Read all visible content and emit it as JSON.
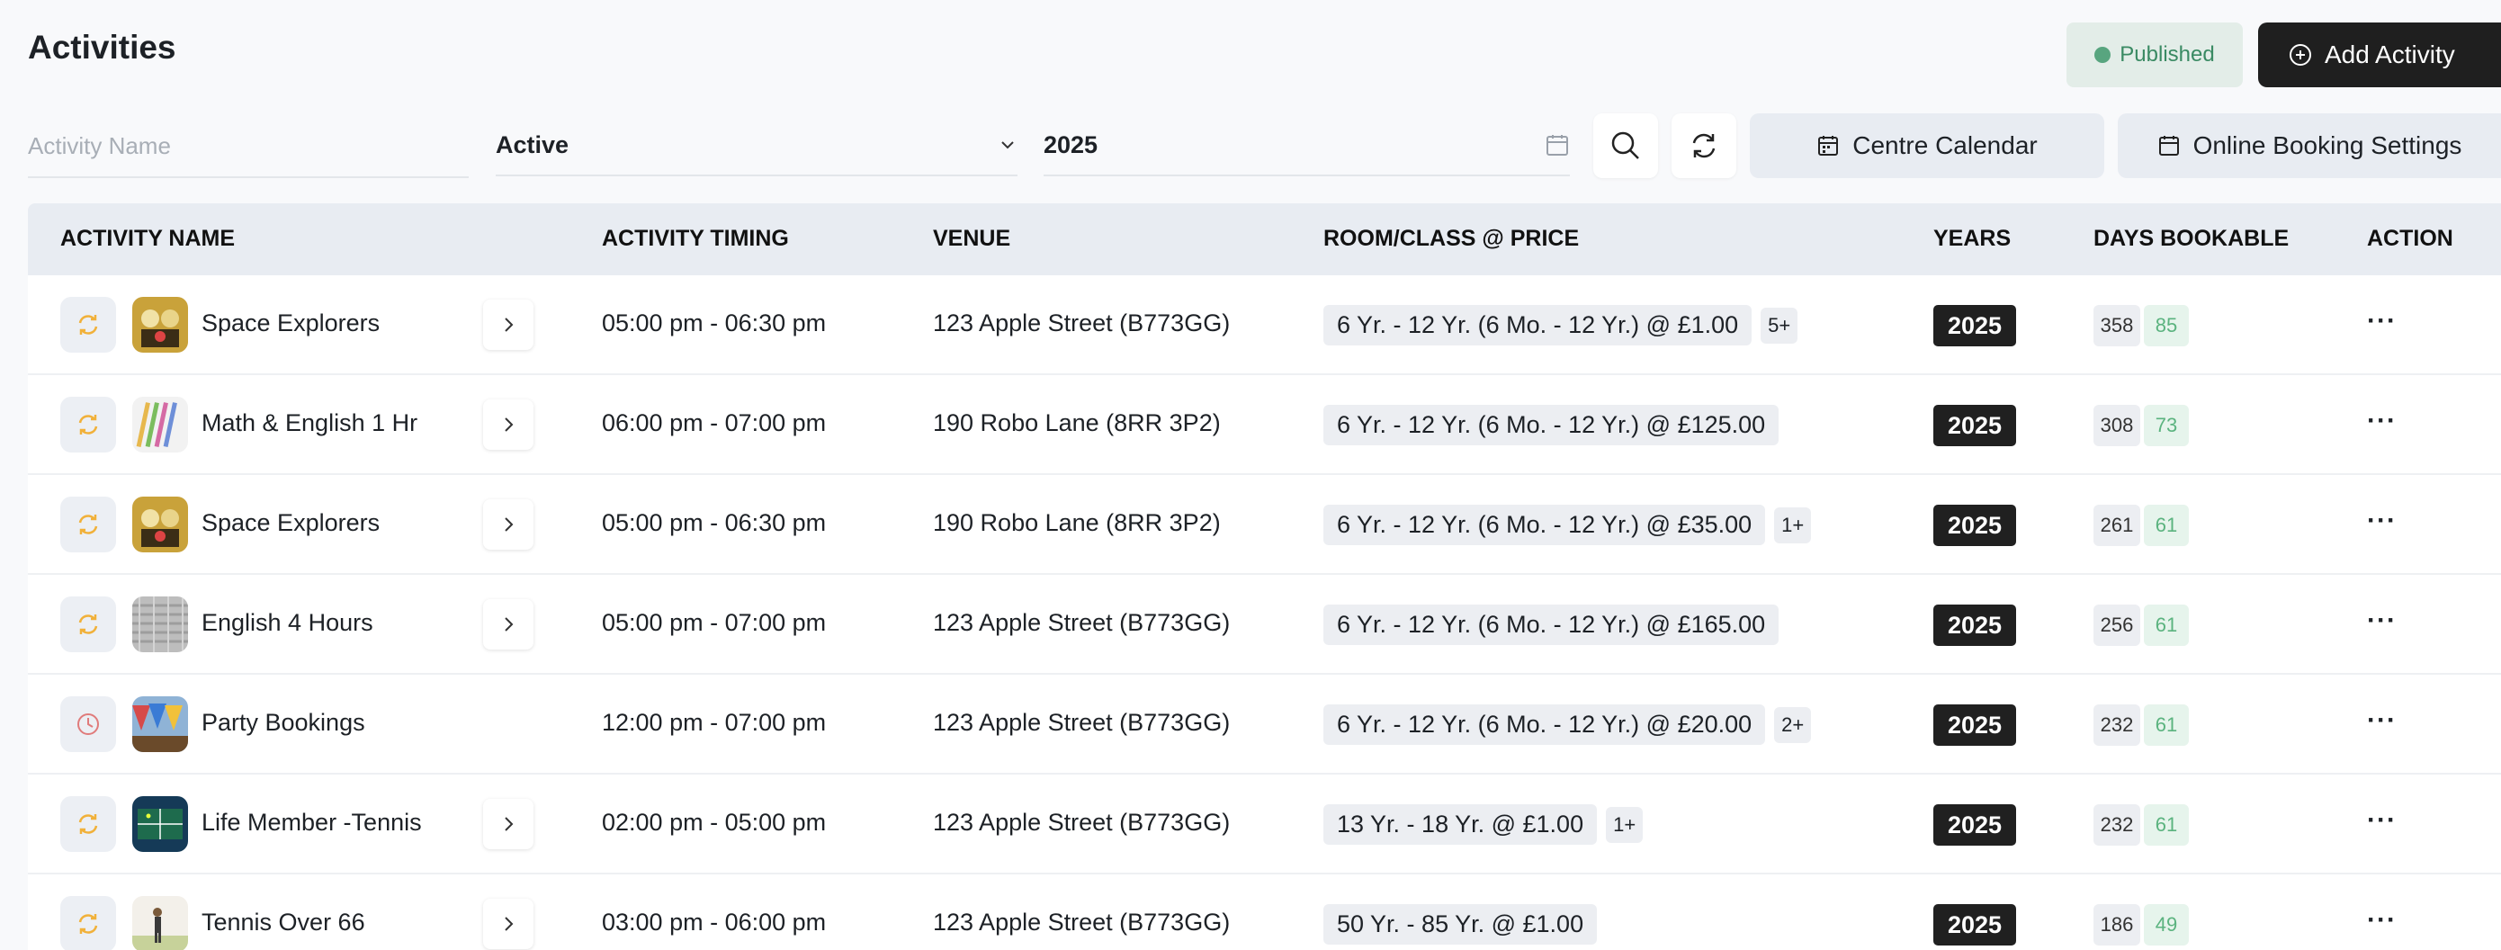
{
  "page": {
    "title": "Activities"
  },
  "header": {
    "published_label": "Published",
    "add_label": "Add Activity"
  },
  "filters": {
    "name_placeholder": "Activity Name",
    "status_value": "Active",
    "year_value": "2025",
    "centre_calendar_label": "Centre Calendar",
    "online_booking_label": "Online Booking Settings"
  },
  "table": {
    "headers": {
      "name": "ACTIVITY NAME",
      "timing": "ACTIVITY TIMING",
      "venue": "VENUE",
      "room": "ROOM/CLASS @ PRICE",
      "years": "YEARS",
      "days": "DAYS BOOKABLE",
      "action": "ACTION"
    },
    "rows": [
      {
        "icon": "repeat-icon",
        "thumb_icon": "space-thumb",
        "name": "Space Explorers",
        "chevron": true,
        "timing": "05:00 pm - 06:30 pm",
        "venue": "123 Apple Street (B773GG)",
        "price": "6 Yr. - 12 Yr. (6 Mo. - 12 Yr.) @ £1.00",
        "more": "5+",
        "year": "2025",
        "days_total": "358",
        "days_left": "85",
        "action": "···"
      },
      {
        "icon": "repeat-icon",
        "thumb_icon": "pencils-thumb",
        "name": "Math & English 1 Hr",
        "chevron": true,
        "timing": "06:00 pm - 07:00 pm",
        "venue": "190 Robo Lane (8RR 3P2)",
        "price": "6 Yr. - 12 Yr. (6 Mo. - 12 Yr.) @ £125.00",
        "more": "",
        "year": "2025",
        "days_total": "308",
        "days_left": "73",
        "action": "···"
      },
      {
        "icon": "repeat-icon",
        "thumb_icon": "space-thumb",
        "name": "Space Explorers",
        "chevron": true,
        "timing": "05:00 pm - 06:30 pm",
        "venue": "190 Robo Lane (8RR 3P2)",
        "price": "6 Yr. - 12 Yr. (6 Mo. - 12 Yr.) @ £35.00",
        "more": "1+",
        "year": "2025",
        "days_total": "261",
        "days_left": "61",
        "action": "···"
      },
      {
        "icon": "repeat-icon",
        "thumb_icon": "texture-thumb",
        "name": "English 4 Hours",
        "chevron": true,
        "timing": "05:00 pm - 07:00 pm",
        "venue": "123 Apple Street (B773GG)",
        "price": "6 Yr. - 12 Yr. (6 Mo. - 12 Yr.) @ £165.00",
        "more": "",
        "year": "2025",
        "days_total": "256",
        "days_left": "61",
        "action": "···"
      },
      {
        "icon": "clock-icon",
        "thumb_icon": "flags-thumb",
        "name": "Party Bookings",
        "chevron": false,
        "timing": "12:00 pm - 07:00 pm",
        "venue": "123 Apple Street (B773GG)",
        "price": "6 Yr. - 12 Yr. (6 Mo. - 12 Yr.) @ £20.00",
        "more": "2+",
        "year": "2025",
        "days_total": "232",
        "days_left": "61",
        "action": "···"
      },
      {
        "icon": "repeat-icon",
        "thumb_icon": "court-thumb",
        "name": "Life Member -Tennis",
        "chevron": true,
        "timing": "02:00 pm - 05:00 pm",
        "venue": "123 Apple Street (B773GG)",
        "price": "13 Yr. - 18 Yr. @ £1.00",
        "more": "1+",
        "year": "2025",
        "days_total": "232",
        "days_left": "61",
        "action": "···"
      },
      {
        "icon": "repeat-icon",
        "thumb_icon": "player-thumb",
        "name": "Tennis Over 66",
        "chevron": true,
        "timing": "03:00 pm - 06:00 pm",
        "venue": "123 Apple Street (B773GG)",
        "price": "50 Yr. - 85 Yr. @ £1.00",
        "more": "",
        "year": "2025",
        "days_total": "186",
        "days_left": "49",
        "action": "···"
      }
    ]
  },
  "colors": {
    "accent_dark": "#1f1f1f",
    "published_green": "#58a57f",
    "repeat_orange": "#f1b13a",
    "clock_red": "#e07b7b",
    "days_green": "#5bb37f"
  }
}
